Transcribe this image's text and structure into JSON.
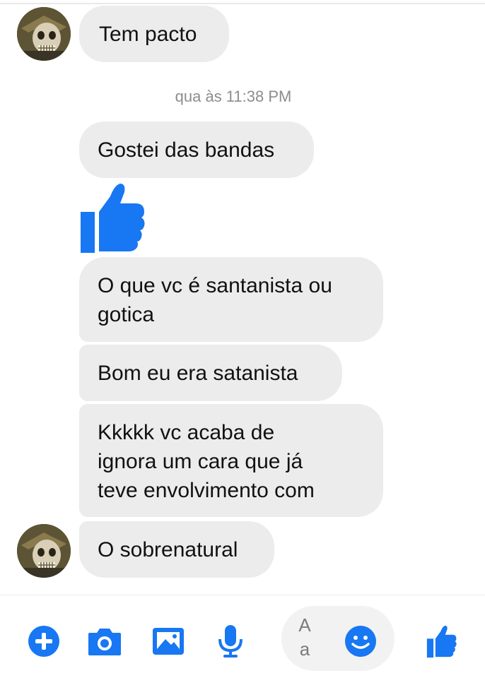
{
  "conversation": {
    "messages": [
      {
        "text": "Tem pacto"
      },
      {
        "text": "Gostei das bandas"
      },
      {
        "text": "O que vc é santanista ou\ngotica"
      },
      {
        "text": "Bom eu era satanista"
      },
      {
        "text": "Kkkkk vc acaba de\nignora um cara que já\nteve envolvimento com"
      },
      {
        "text": "O sobrenatural"
      }
    ],
    "timestamp": "qua às 11:38 PM",
    "sent_reaction": "thumbs-up-icon"
  },
  "composer": {
    "placeholder": "Aa",
    "icons": [
      "plus-icon",
      "camera-icon",
      "image-icon",
      "microphone-icon",
      "emoji-icon",
      "thumbs-up-icon"
    ],
    "accent_color": "#1877f2"
  },
  "colors": {
    "bubble": "#ececec",
    "background": "#ffffff",
    "timestamp": "#8d8d8d"
  }
}
